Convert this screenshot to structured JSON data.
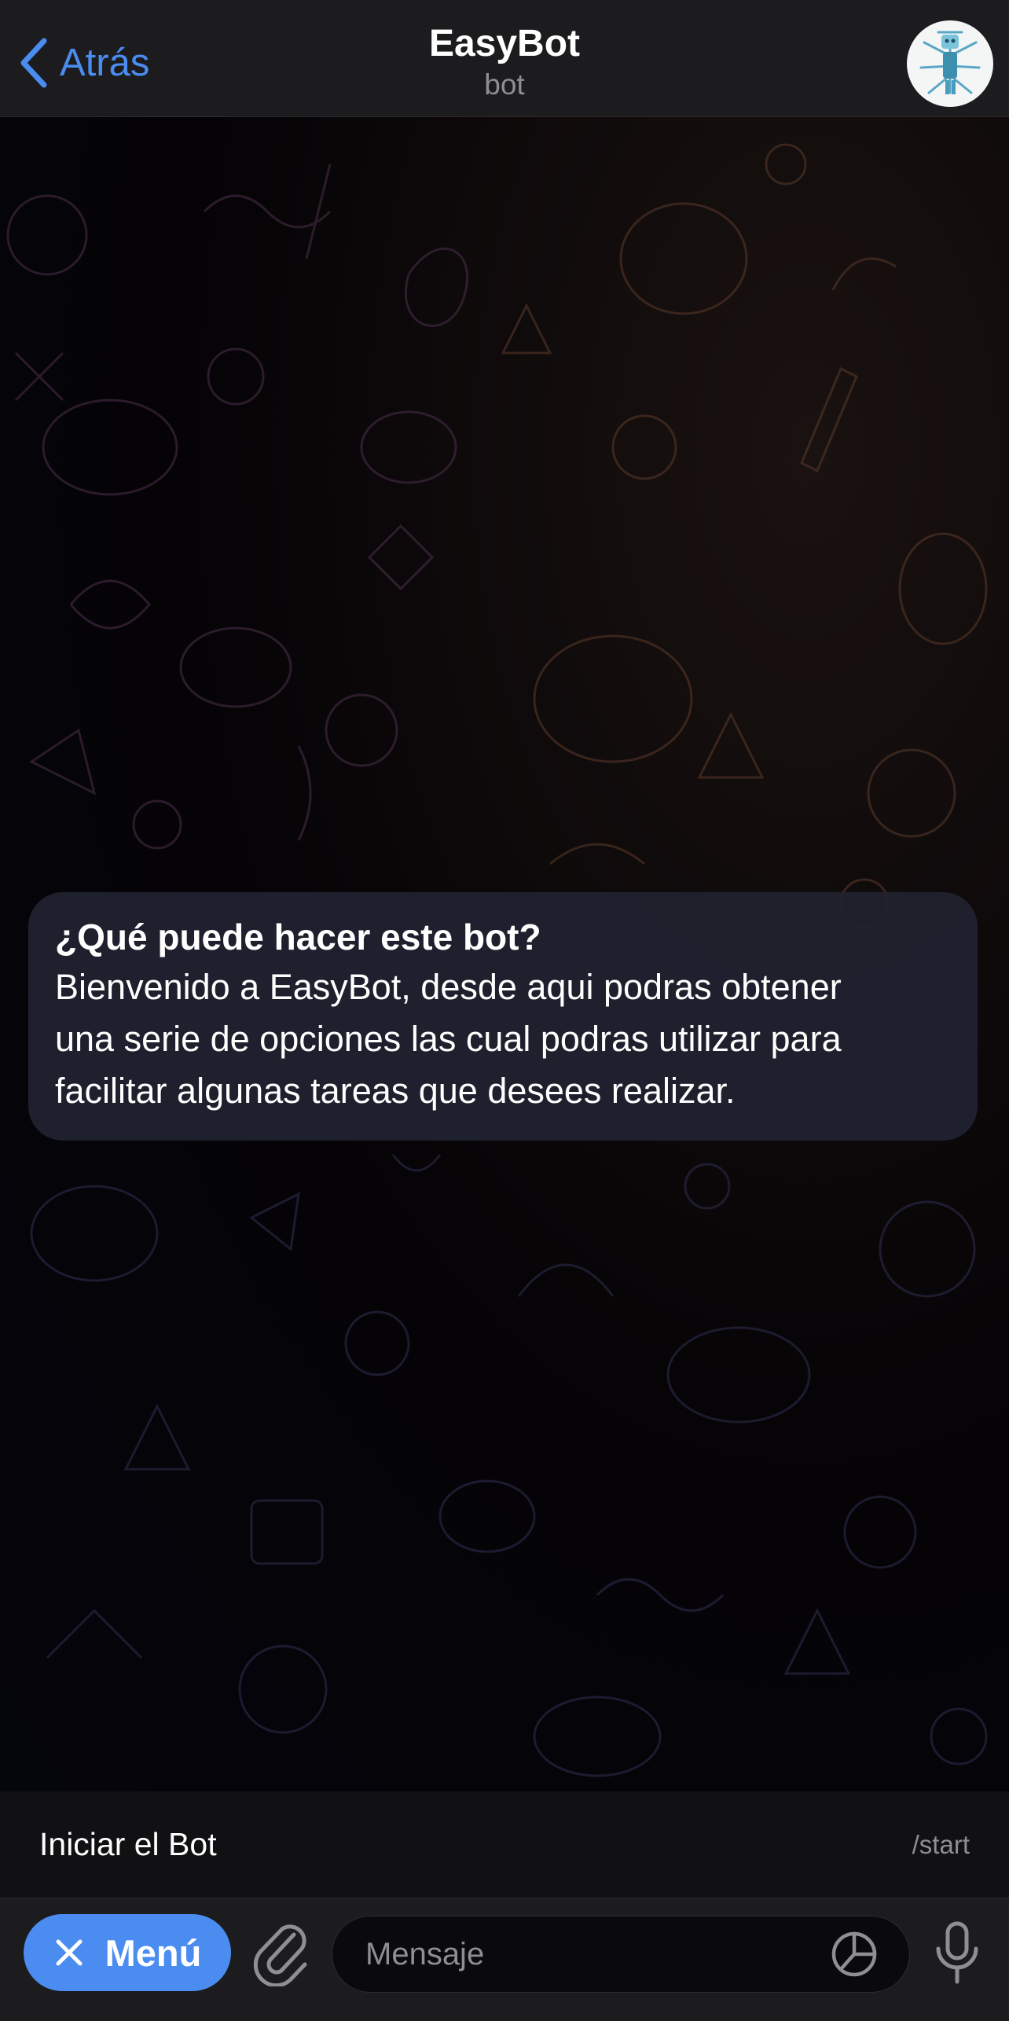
{
  "header": {
    "back_label": "Atrás",
    "title": "EasyBot",
    "subtitle": "bot"
  },
  "bubble": {
    "title": "¿Qué puede hacer este bot?",
    "lines": [
      "Bienvenido a EasyBot, desde aqui podras obtener",
      "una serie de opciones las cual podras utilizar para",
      "facilitar algunas tareas que desees realizar."
    ]
  },
  "command": {
    "label": "Iniciar el Bot",
    "value": "/start"
  },
  "input": {
    "menu_label": "Menú",
    "placeholder": "Mensaje"
  },
  "colors": {
    "accent": "#4a8cf0",
    "header_bg": "#1c1c1e",
    "bubble_bg": "#212230"
  },
  "icons": [
    "chevron-left-icon",
    "close-icon",
    "paperclip-icon",
    "sticker-icon",
    "microphone-icon"
  ]
}
